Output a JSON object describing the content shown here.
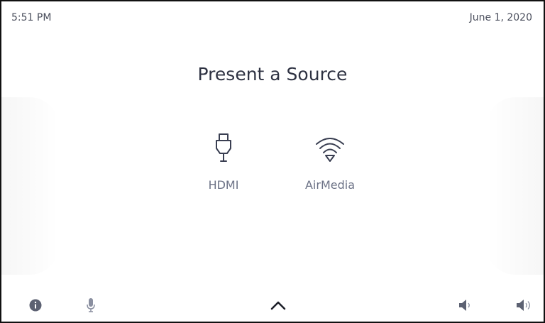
{
  "status_bar": {
    "time": "5:51 PM",
    "date": "June 1, 2020"
  },
  "main": {
    "title": "Present a Source",
    "sources": [
      {
        "label": "HDMI",
        "icon": "hdmi-icon"
      },
      {
        "label": "AirMedia",
        "icon": "wifi-icon"
      }
    ]
  },
  "bottom_bar": {
    "icons": [
      "info-icon",
      "microphone-icon",
      "chevron-up-icon",
      "volume-down-icon",
      "volume-up-icon"
    ]
  },
  "colors": {
    "icon": "#3a3f52",
    "text": "#2e3242",
    "label": "#6c7286",
    "muted_icon": "#8a8fa0"
  }
}
